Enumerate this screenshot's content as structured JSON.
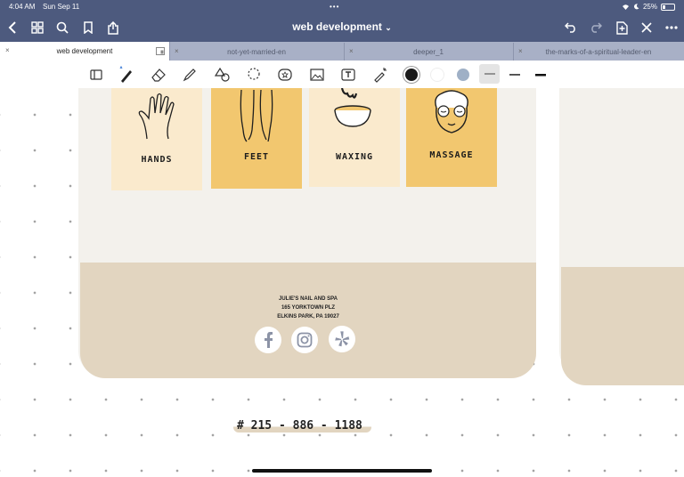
{
  "status": {
    "time": "4:04 AM",
    "date": "Sun Sep 11",
    "battery": "25%",
    "battery_level": 0.25
  },
  "nav": {
    "title": "web development",
    "dropdown": "⌄"
  },
  "tabs": [
    {
      "label": "web development",
      "active": true
    },
    {
      "label": "not-yet-married-en"
    },
    {
      "label": "deeper_1"
    },
    {
      "label": "the-marks-of-a-spiritual-leader-en"
    }
  ],
  "toolbar": {
    "tools": [
      "layout-icon",
      "pen-icon",
      "eraser-icon",
      "highlighter-icon",
      "shapes-icon",
      "lasso-icon",
      "sticker-icon",
      "image-icon",
      "text-icon",
      "laser-pointer-icon"
    ],
    "colors": [
      "#1a1a1a",
      "#ffffff",
      "#9fb0c6"
    ]
  },
  "cards": [
    {
      "label": "HANDS",
      "bg": "#faeacd"
    },
    {
      "label": "FEET",
      "bg": "#f2c76f"
    },
    {
      "label": "WAXING",
      "bg": "#faeacd"
    },
    {
      "label": "MASSAGE",
      "bg": "#f2c76f"
    }
  ],
  "address": {
    "line1": "JULIE'S NAIL AND SPA",
    "line2": "165 YORKTOWN PLZ",
    "line3": "ELKINS PARK, PA 19027"
  },
  "social": [
    "facebook-icon",
    "instagram-icon",
    "yelp-icon"
  ],
  "phone": "# 215 - 886 - 1188"
}
